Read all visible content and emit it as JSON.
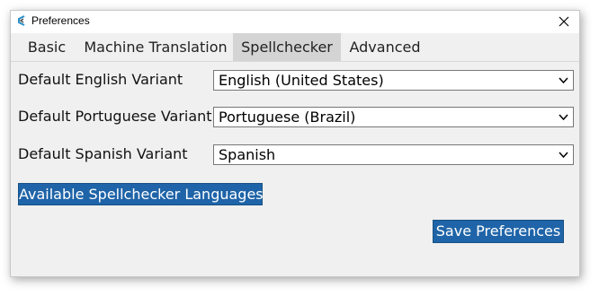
{
  "window": {
    "title": "Preferences",
    "icons": {
      "app": "app-logo-icon",
      "close": "close-icon"
    }
  },
  "tabs": [
    {
      "label": "Basic",
      "active": false
    },
    {
      "label": "Machine Translation",
      "active": false
    },
    {
      "label": "Spellchecker",
      "active": true
    },
    {
      "label": "Advanced",
      "active": false
    }
  ],
  "settings": {
    "english": {
      "label": "Default English Variant",
      "value": "English (United States)"
    },
    "portuguese": {
      "label": "Default Portuguese Variant",
      "value": "Portuguese (Brazil)"
    },
    "spanish": {
      "label": "Default Spanish Variant",
      "value": "Spanish"
    }
  },
  "buttons": {
    "languages": "Available Spellchecker Languages",
    "save": "Save Preferences"
  },
  "colors": {
    "accent_button": "#1f64a8",
    "active_tab": "#d4d4d4",
    "window_bg": "#f0f0f0"
  }
}
